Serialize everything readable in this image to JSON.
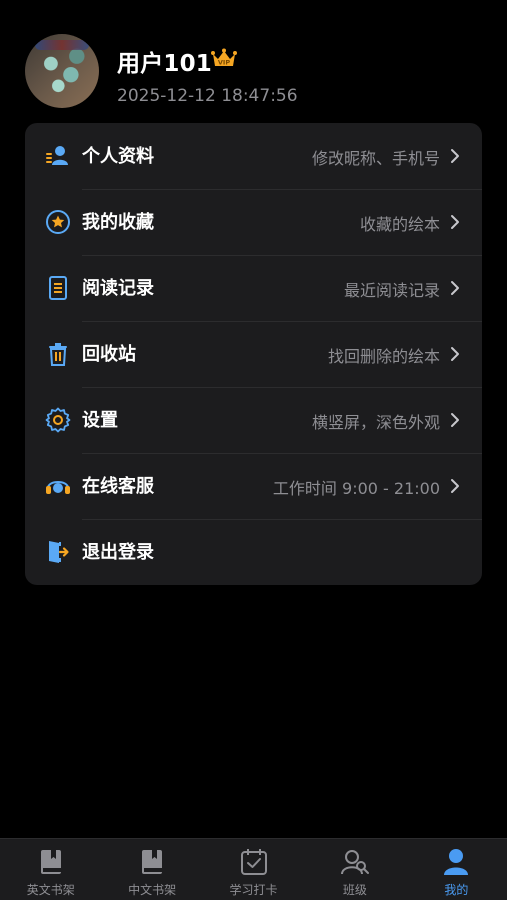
{
  "profile": {
    "username": "用户101",
    "timestamp": "2025-12-12 18:47:56",
    "vip_badge": "VIP"
  },
  "menu": [
    {
      "label": "个人资料",
      "hint": "修改昵称、手机号",
      "icon": "user-profile-icon"
    },
    {
      "label": "我的收藏",
      "hint": "收藏的绘本",
      "icon": "star-icon"
    },
    {
      "label": "阅读记录",
      "hint": "最近阅读记录",
      "icon": "document-list-icon"
    },
    {
      "label": "回收站",
      "hint": "找回删除的绘本",
      "icon": "trash-icon"
    },
    {
      "label": "设置",
      "hint": "横竖屏，深色外观",
      "icon": "gear-icon"
    },
    {
      "label": "在线客服",
      "hint": "工作时间 9:00 - 21:00",
      "icon": "headset-icon"
    },
    {
      "label": "退出登录",
      "hint": "",
      "icon": "logout-icon"
    }
  ],
  "tabbar": [
    {
      "label": "英文书架",
      "icon": "book-icon",
      "active": false
    },
    {
      "label": "中文书架",
      "icon": "book-icon",
      "active": false
    },
    {
      "label": "学习打卡",
      "icon": "calendar-check-icon",
      "active": false
    },
    {
      "label": "班级",
      "icon": "people-icon",
      "active": false
    },
    {
      "label": "我的",
      "icon": "person-icon",
      "active": true
    }
  ],
  "colors": {
    "accent": "#4a9bf2",
    "icon_blue": "#5aa9f5",
    "icon_yellow": "#f5a623",
    "card_bg": "#1c1c1e",
    "hint": "#8e8e93"
  }
}
